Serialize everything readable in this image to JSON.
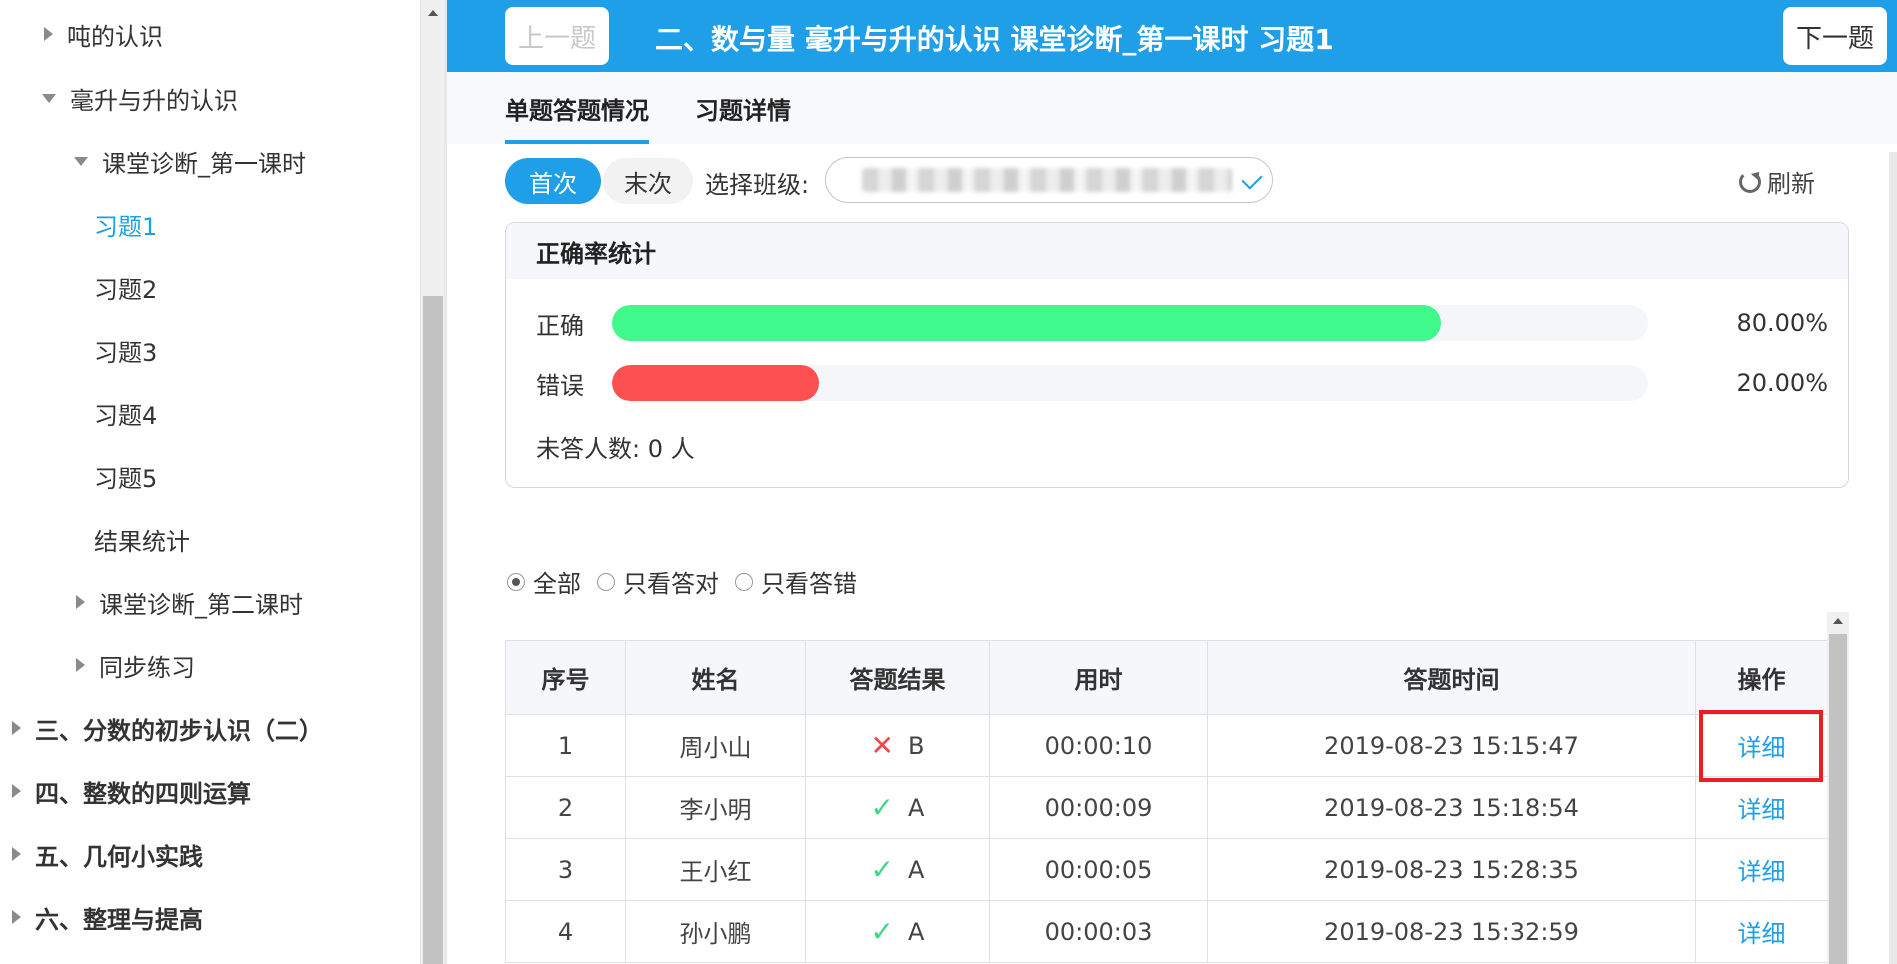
{
  "sidebar": {
    "items": [
      {
        "label": "吨的认识",
        "arrow": "right"
      },
      {
        "label": "毫升与升的认识",
        "arrow": "down"
      },
      {
        "label": "课堂诊断_第一课时",
        "arrow": "down"
      },
      {
        "label": "习题1",
        "active": true
      },
      {
        "label": "习题2"
      },
      {
        "label": "习题3"
      },
      {
        "label": "习题4"
      },
      {
        "label": "习题5"
      },
      {
        "label": "结果统计"
      },
      {
        "label": "课堂诊断_第二课时",
        "arrow": "right"
      },
      {
        "label": "同步练习",
        "arrow": "right"
      },
      {
        "label": "三、分数的初步认识（二）",
        "arrow": "right",
        "bold": true
      },
      {
        "label": "四、整数的四则运算",
        "arrow": "right",
        "bold": true
      },
      {
        "label": "五、几何小实践",
        "arrow": "right",
        "bold": true
      },
      {
        "label": "六、整理与提高",
        "arrow": "right",
        "bold": true
      }
    ]
  },
  "topbar": {
    "prev_label": "上一题",
    "next_label": "下一题",
    "title": "二、数与量 毫升与升的认识 课堂诊断_第一课时 习题1"
  },
  "tabs": [
    {
      "label": "单题答题情况",
      "active": true
    },
    {
      "label": "习题详情",
      "active": false
    }
  ],
  "filters": {
    "first_label": "首次",
    "last_label": "末次",
    "class_label": "选择班级:",
    "refresh_label": "刷新"
  },
  "stats": {
    "title": "正确率统计",
    "correct_label": "正确",
    "correct_pct": "80.00%",
    "correct_fraction": 0.8,
    "wrong_label": "错误",
    "wrong_pct": "20.00%",
    "wrong_fraction": 0.2,
    "unanswered": "未答人数: 0  人",
    "colors": {
      "correct": "#3ff98c",
      "wrong": "#fd5050"
    }
  },
  "radios": [
    {
      "label": "全部",
      "checked": true
    },
    {
      "label": "只看答对",
      "checked": false
    },
    {
      "label": "只看答错",
      "checked": false
    }
  ],
  "table": {
    "headers": [
      "序号",
      "姓名",
      "答题结果",
      "用时",
      "答题时间",
      "操作"
    ],
    "rows": [
      {
        "no": "1",
        "name": "周小山",
        "icon": "cross-icon",
        "answer": "B",
        "duration": "00:00:10",
        "time": "2019-08-23 15:15:47",
        "action": "详细"
      },
      {
        "no": "2",
        "name": "李小明",
        "icon": "check-icon",
        "answer": "A",
        "duration": "00:00:09",
        "time": "2019-08-23 15:18:54",
        "action": "详细"
      },
      {
        "no": "3",
        "name": "王小红",
        "icon": "check-icon",
        "answer": "A",
        "duration": "00:00:05",
        "time": "2019-08-23 15:28:35",
        "action": "详细"
      },
      {
        "no": "4",
        "name": "孙小鹏",
        "icon": "check-icon",
        "answer": "A",
        "duration": "00:00:03",
        "time": "2019-08-23 15:32:59",
        "action": "详细"
      }
    ]
  },
  "colors": {
    "accent": "#1f9fe8",
    "highlight": "#ee1d24"
  }
}
